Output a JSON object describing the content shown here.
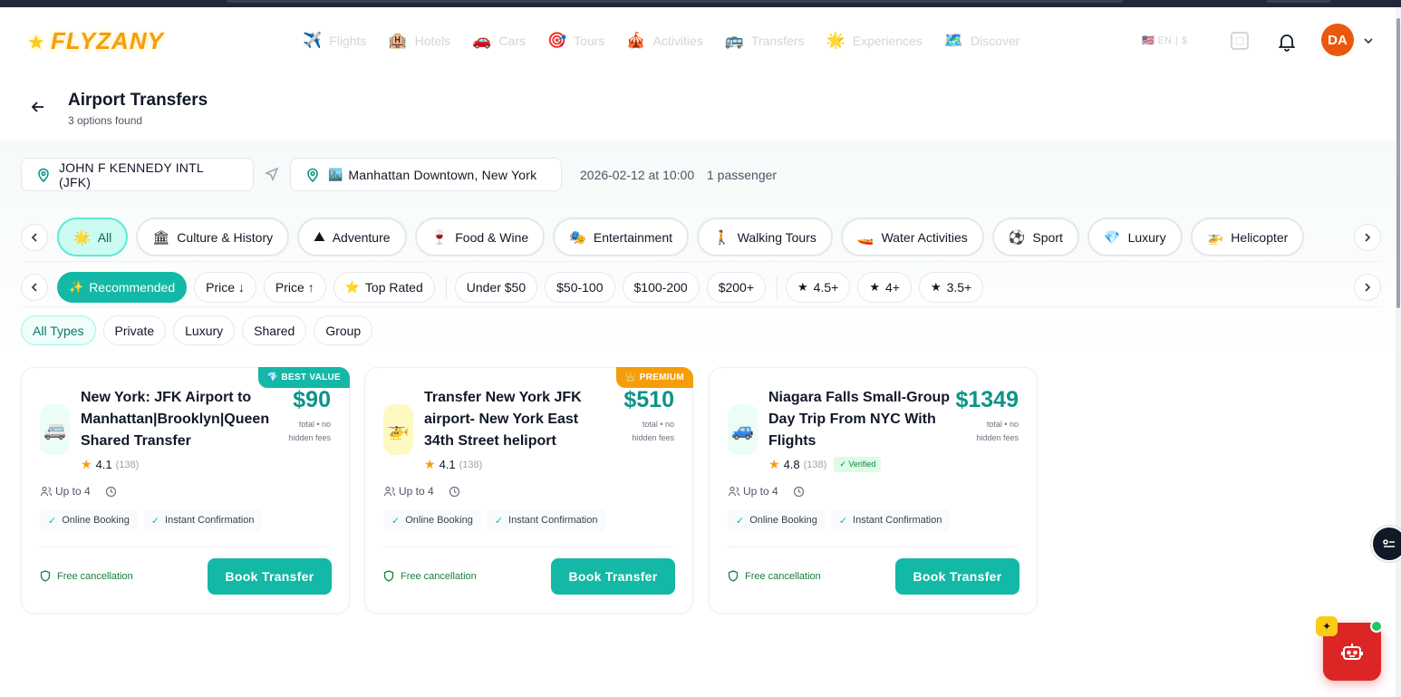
{
  "brand": {
    "logo_text": "FLYZANY"
  },
  "nav": [
    {
      "icon": "✈️",
      "label": "Flights"
    },
    {
      "icon": "🏨",
      "label": "Hotels"
    },
    {
      "icon": "🚗",
      "label": "Cars"
    },
    {
      "icon": "🎯",
      "label": "Tours"
    },
    {
      "icon": "🎪",
      "label": "Activities"
    },
    {
      "icon": "🚌",
      "label": "Transfers"
    },
    {
      "icon": "🌟",
      "label": "Experiences"
    },
    {
      "icon": "🗺️",
      "label": "Discover"
    }
  ],
  "header": {
    "lang": "EN",
    "currency": "$",
    "avatar_initials": "DA"
  },
  "page": {
    "title": "Airport Transfers",
    "subtitle": "3 options found"
  },
  "search": {
    "from": "JOHN F KENNEDY INTL (JFK)",
    "to_icon": "🏙️",
    "to": "Manhattan Downtown, New York",
    "datetime": "2026-02-12 at 10:00",
    "passengers": "1 passenger"
  },
  "categories": [
    {
      "icon": "🌟",
      "label": "All",
      "active": true
    },
    {
      "icon": "🏛",
      "label": "Culture & History"
    },
    {
      "icon": "⛰",
      "label": "Adventure"
    },
    {
      "icon": "🍷",
      "label": "Food & Wine"
    },
    {
      "icon": "🎭",
      "label": "Entertainment"
    },
    {
      "icon": "🚶",
      "label": "Walking Tours"
    },
    {
      "icon": "🚤",
      "label": "Water Activities"
    },
    {
      "icon": "⚽",
      "label": "Sport"
    },
    {
      "icon": "💎",
      "label": "Luxury"
    },
    {
      "icon": "🚁",
      "label": "Helicopter"
    }
  ],
  "sort_filters": [
    {
      "icon": "✨",
      "label": "Recommended",
      "active": true
    },
    {
      "icon": "",
      "label": "Price ↓"
    },
    {
      "icon": "",
      "label": "Price ↑"
    },
    {
      "icon": "⭐",
      "label": "Top Rated"
    }
  ],
  "price_filters": [
    "Under $50",
    "$50-100",
    "$100-200",
    "$200+"
  ],
  "rating_filters": [
    "4.5+",
    "4+",
    "3.5+"
  ],
  "types": [
    {
      "label": "All Types",
      "active": true
    },
    {
      "label": "Private"
    },
    {
      "label": "Luxury"
    },
    {
      "label": "Shared"
    },
    {
      "label": "Group"
    }
  ],
  "cards": [
    {
      "badge": "💎 BEST VALUE",
      "badge_color": "#14b8a6",
      "vehicle_icon": "🚐",
      "title": "New York: JFK Airport to Manhattan|Brooklyn|Queen Shared Transfer",
      "price": "$90",
      "price_note": "total • no hidden fees",
      "rating": "4.1",
      "reviews": "(138)",
      "verified": "",
      "capacity": "Up to 4",
      "features": [
        "Online Booking",
        "Instant Confirmation"
      ],
      "cancel": "Free cancellation",
      "cta": "Book Transfer"
    },
    {
      "badge": "👑 PREMIUM",
      "badge_color": "#f59e0b",
      "vehicle_icon": "🚁",
      "title": "Transfer New York JFK airport- New York East 34th Street heliport",
      "price": "$510",
      "price_note": "total • no hidden fees",
      "rating": "4.1",
      "reviews": "(138)",
      "verified": "",
      "capacity": "Up to 4",
      "features": [
        "Online Booking",
        "Instant Confirmation"
      ],
      "cancel": "Free cancellation",
      "cta": "Book Transfer"
    },
    {
      "badge": "",
      "badge_color": "",
      "vehicle_icon": "🚙",
      "title": "Niagara Falls Small-Group Day Trip From NYC With Flights",
      "price": "$1349",
      "price_note": "total • no hidden fees",
      "rating": "4.8",
      "reviews": "(138)",
      "verified": "✓ Verified",
      "capacity": "Up to 4",
      "features": [
        "Online Booking",
        "Instant Confirmation"
      ],
      "cancel": "Free cancellation",
      "cta": "Book Transfer"
    }
  ],
  "colors": {
    "accent": "#14b8a6",
    "price": "#0d9488",
    "avatar": "#ea580c",
    "bot": "#dc2626"
  }
}
